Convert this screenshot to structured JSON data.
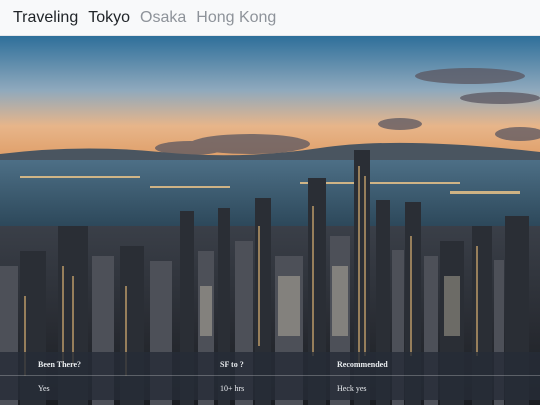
{
  "navbar": {
    "brand": "Traveling",
    "links": [
      {
        "label": "Tokyo",
        "active": true
      },
      {
        "label": "Osaka",
        "active": false
      },
      {
        "label": "Hong Kong",
        "active": false
      }
    ]
  },
  "info_table": {
    "headers": [
      "Been There?",
      "SF to ?",
      "Recommended"
    ],
    "rows": [
      [
        "Yes",
        "10+ hrs",
        "Heck yes"
      ]
    ]
  }
}
